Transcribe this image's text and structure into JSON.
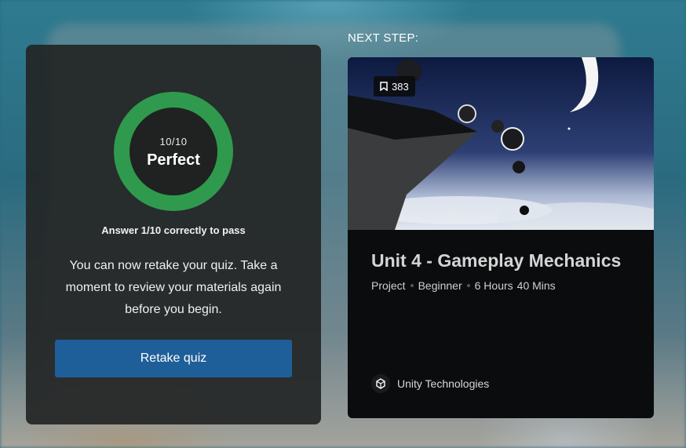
{
  "quiz": {
    "score": "10/10",
    "result_label": "Perfect",
    "pass_requirement": "Answer 1/10 correctly to pass",
    "message": "You can now retake your quiz. Take a moment to review your materials again before you begin.",
    "retake_label": "Retake quiz",
    "ring_color": "#2f9a4d",
    "button_color": "#1f5f99"
  },
  "next_step": {
    "heading": "NEXT STEP:",
    "bookmark_count": "383",
    "title": "Unit 4 - Gameplay Mechanics",
    "type": "Project",
    "level": "Beginner",
    "duration_hours": "6 Hours",
    "duration_minutes": "40 Mins",
    "author": "Unity Technologies",
    "icons": [
      "bookmark-icon",
      "unity-logo-icon"
    ]
  }
}
